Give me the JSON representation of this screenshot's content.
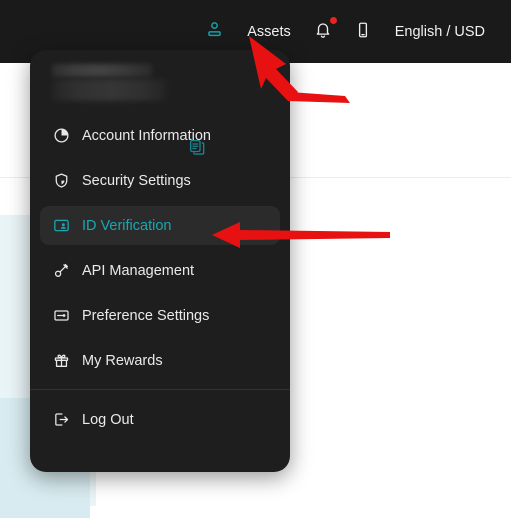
{
  "header": {
    "items": [
      {
        "id": "user",
        "label": "",
        "icon": "user-person-icon",
        "color": "#18a0a8"
      },
      {
        "id": "assets",
        "label": "Assets",
        "icon": ""
      },
      {
        "id": "notifications",
        "label": "",
        "icon": "bell-icon",
        "badge": true,
        "badge_color": "#ef2020"
      },
      {
        "id": "mobile",
        "label": "",
        "icon": "mobile-phone-icon"
      },
      {
        "id": "locale",
        "label": "English / USD",
        "icon": ""
      }
    ],
    "background": "#1a1a1a"
  },
  "dropdown": {
    "account": {
      "name_redacted": "",
      "id_redacted": "",
      "copy_icon": "copy-icon"
    },
    "items": [
      {
        "id": "account-information",
        "label": "Account Information",
        "icon": "pie-chart-icon",
        "active": false
      },
      {
        "id": "security-settings",
        "label": "Security Settings",
        "icon": "shield-icon",
        "active": false
      },
      {
        "id": "id-verification",
        "label": "ID Verification",
        "icon": "id-card-icon",
        "active": true
      },
      {
        "id": "api-management",
        "label": "API Management",
        "icon": "key-plug-icon",
        "active": false
      },
      {
        "id": "preference-settings",
        "label": "Preference Settings",
        "icon": "sliders-arrow-icon",
        "active": false
      },
      {
        "id": "my-rewards",
        "label": "My Rewards",
        "icon": "gift-icon",
        "active": false
      }
    ],
    "logout": {
      "id": "log-out",
      "label": "Log Out",
      "icon": "logout-arrow-icon"
    },
    "background": "#1e1e1e",
    "active_color": "#18a8b2",
    "active_row_background": "#2b2b2b"
  },
  "annotations": {
    "arrow_color": "#e81111",
    "arrows": [
      {
        "id": "arrow-to-user-icon",
        "target": "user-person-icon"
      },
      {
        "id": "arrow-to-id-verification",
        "target": "id-verification"
      }
    ]
  }
}
